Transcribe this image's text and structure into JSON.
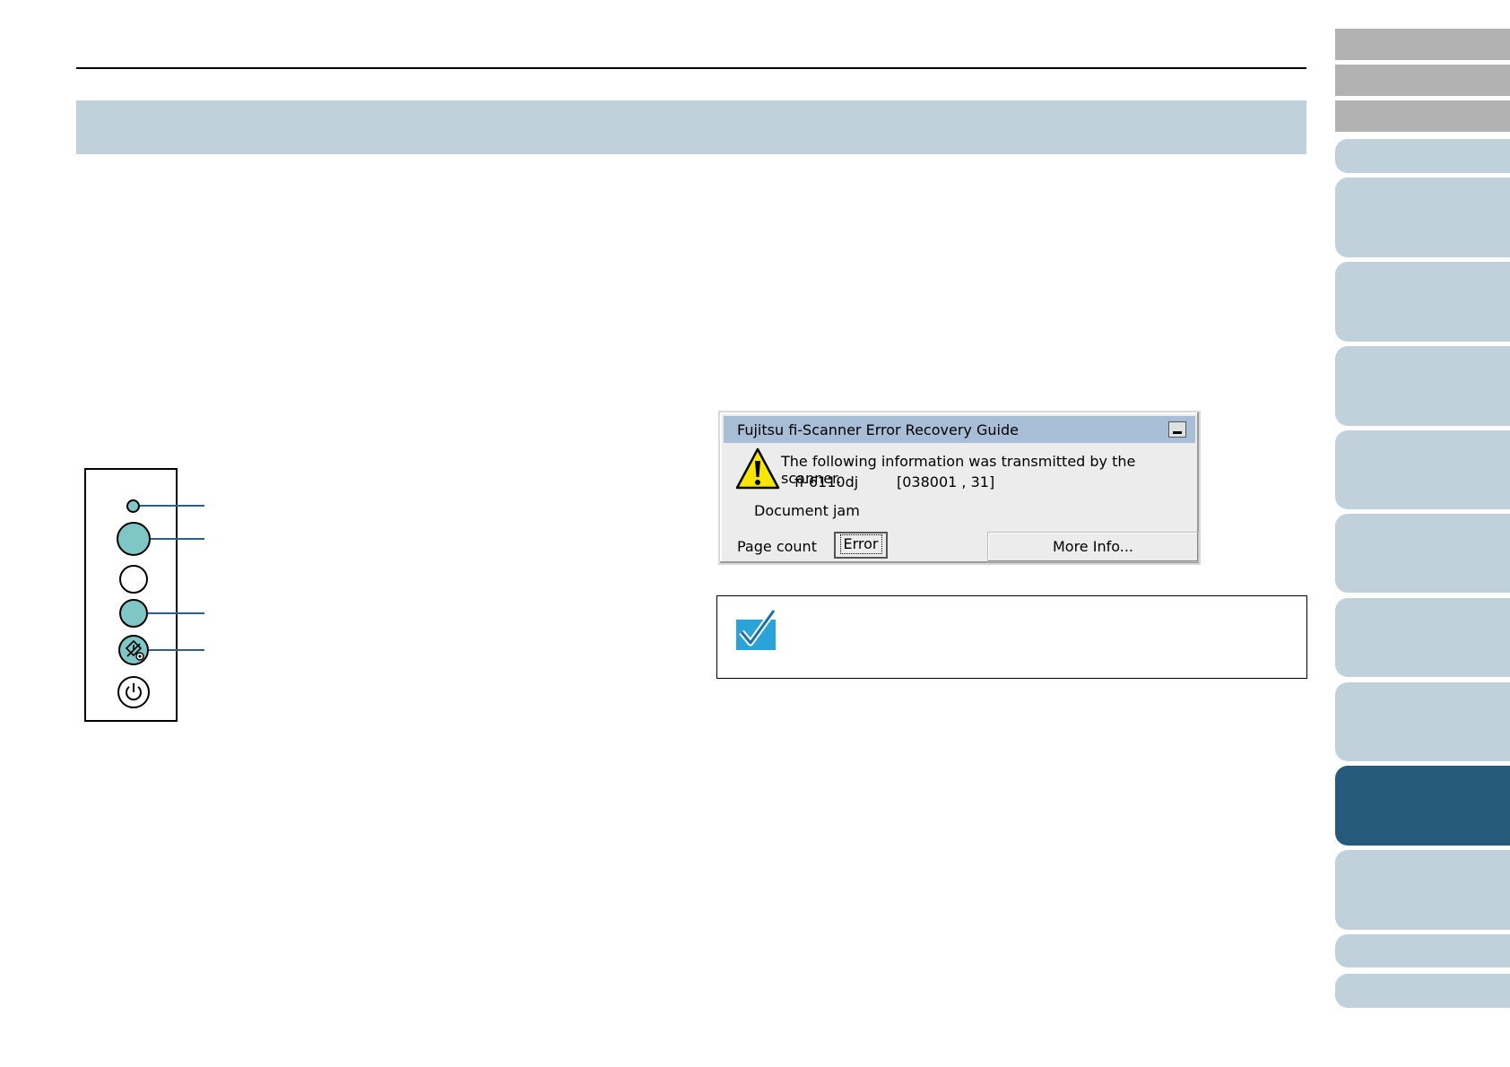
{
  "dialog": {
    "title": "Fujitsu fi-Scanner Error Recovery Guide",
    "message": "The following information was transmitted by the scanner.",
    "model": "fi-6110dj",
    "code": "[038001 , 31]",
    "status": "Document jam",
    "page_count_label": "Page count",
    "error_button": "Error",
    "more_info_button": "More Info..."
  },
  "icons": {
    "warning": "warning-icon",
    "check": "checkmark-icon",
    "stop": "stop-clear-icon",
    "power": "power-icon",
    "minimize": "minimize-icon"
  },
  "colors": {
    "header_band": "#c0d1db",
    "side_tab": "#c0d1db",
    "side_tab_top": "#b2b2b2",
    "side_tab_active": "#255a7a",
    "dialog_titlebar": "#a8bdd6",
    "lamp_teal": "#7fc6c6",
    "callout_line": "#2f5f87",
    "check_blue": "#2aa3d8"
  }
}
